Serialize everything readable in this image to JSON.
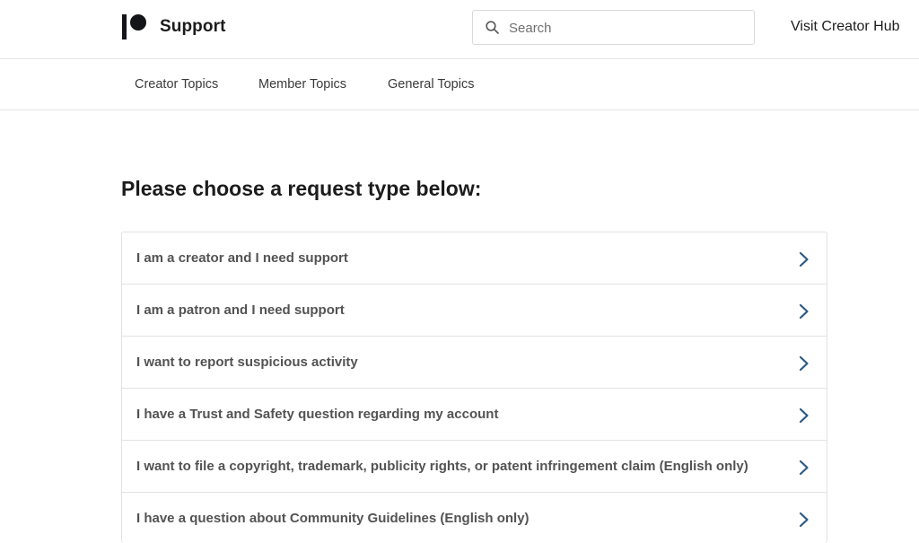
{
  "header": {
    "brand": "Support",
    "search_placeholder": "Search",
    "creator_hub_link": "Visit Creator Hub"
  },
  "nav": {
    "tabs": [
      {
        "label": "Creator Topics"
      },
      {
        "label": "Member Topics"
      },
      {
        "label": "General Topics"
      }
    ]
  },
  "main": {
    "title": "Please choose a request type below:",
    "requests": [
      {
        "label": "I am a creator and I need support"
      },
      {
        "label": "I am a patron and I need support"
      },
      {
        "label": "I want to report suspicious activity"
      },
      {
        "label": "I have a Trust and Safety question regarding my account"
      },
      {
        "label": "I want to file a copyright, trademark, publicity rights, or patent infringement claim (English only)"
      },
      {
        "label": "I have a question about Community Guidelines (English only)"
      }
    ]
  },
  "icons": {
    "logo": "patreon-logo",
    "search": "search-icon",
    "chevron": "chevron-right-icon"
  },
  "colors": {
    "logo": "#141518",
    "chevron": "#2a5a86",
    "border": "#e2e2e2",
    "item_text": "#535353"
  }
}
